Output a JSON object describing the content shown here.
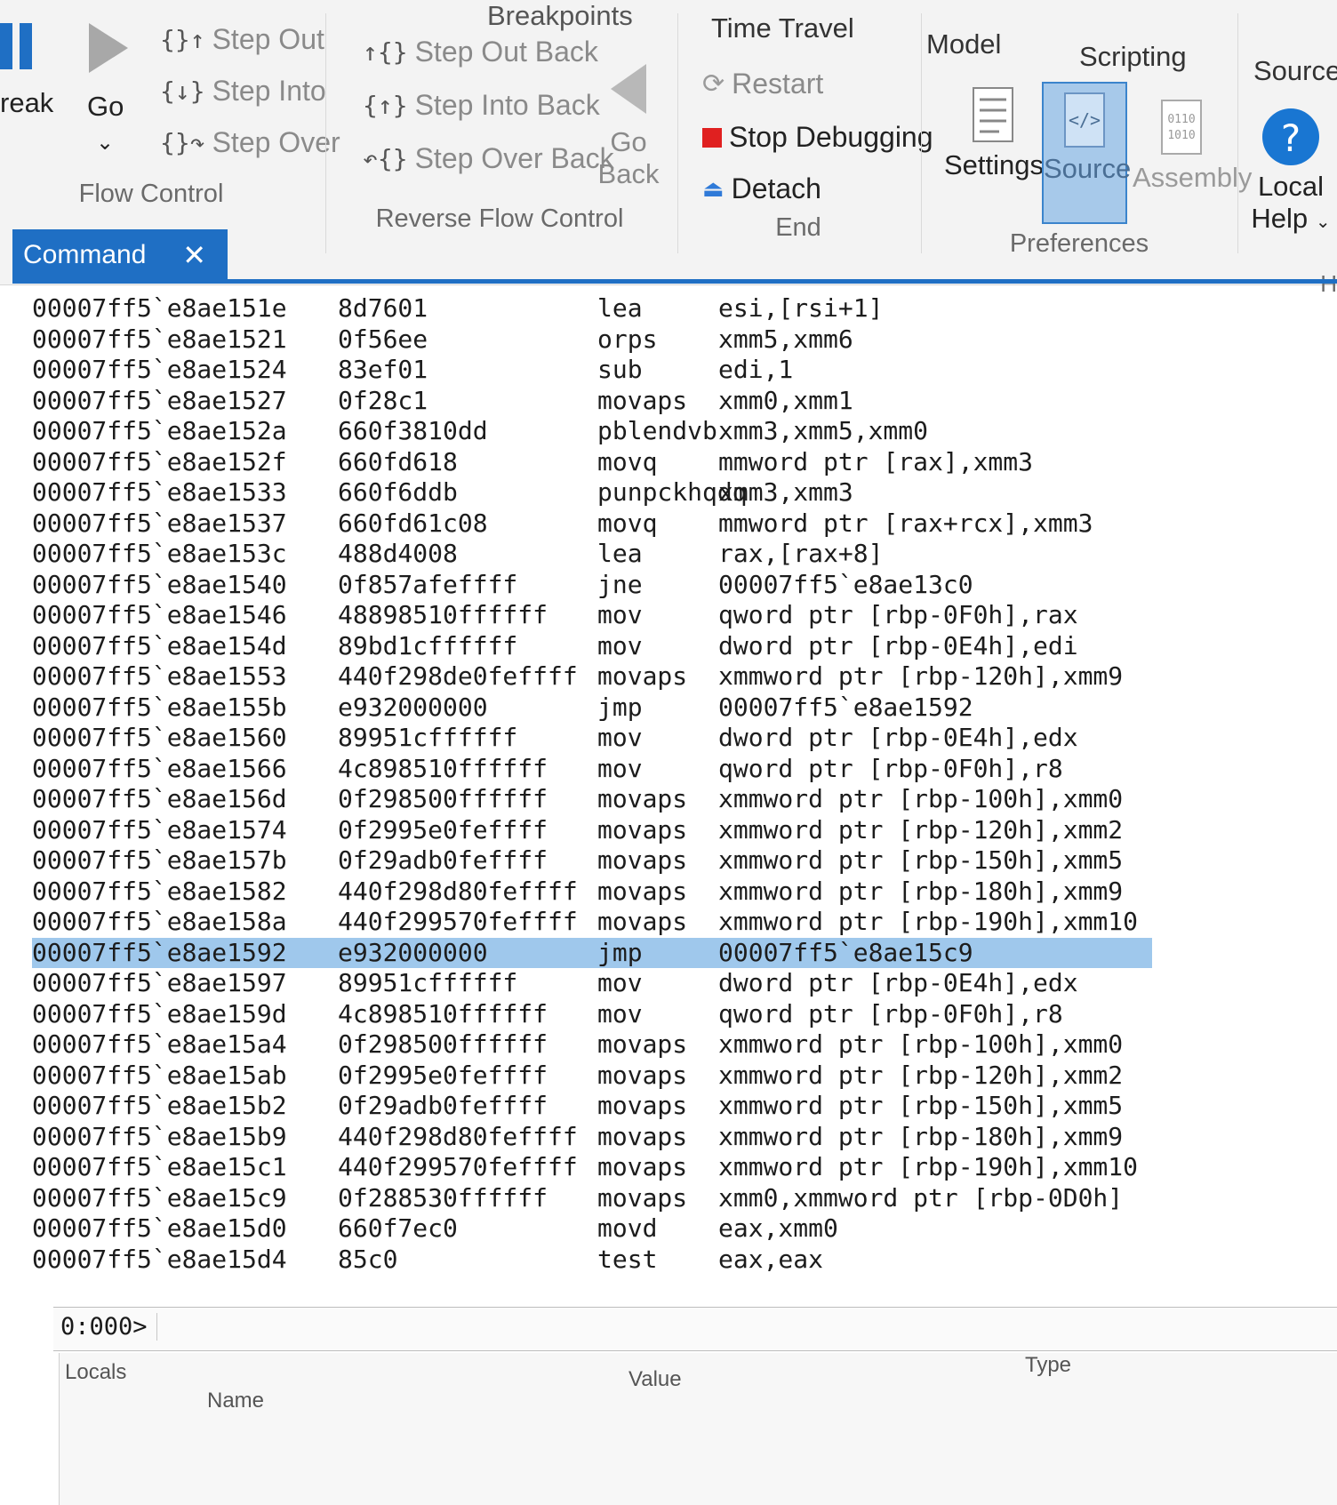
{
  "ribbon": {
    "tabs": [
      "Breakpoints",
      "Time Travel",
      "Model",
      "Scripting",
      "Source"
    ],
    "flow_control": {
      "break_label": "reak",
      "go_label": "Go",
      "step_out": "Step Out",
      "step_into": "Step Into",
      "step_over": "Step Over",
      "group_label": "Flow Control"
    },
    "reverse_flow": {
      "step_out_back": "Step Out Back",
      "step_into_back": "Step Into Back",
      "step_over_back": "Step Over Back",
      "go_back_line1": "Go",
      "go_back_line2": "Back",
      "group_label": "Reverse Flow Control"
    },
    "end": {
      "restart": "Restart",
      "stop_debugging": "Stop Debugging",
      "detach": "Detach",
      "group_label": "End"
    },
    "preferences": {
      "settings": "Settings",
      "source": "Source",
      "assembly": "Assembly",
      "group_label": "Preferences"
    },
    "help": {
      "line1": "Local",
      "line2": "Help",
      "group_label_partial": "H"
    },
    "colors": {
      "accent": "#1f6fc4",
      "stop": "#e02020",
      "detach": "#2f7ad8",
      "help_circle": "#1976d2"
    }
  },
  "command_tab": {
    "label": "Command"
  },
  "disassembly": [
    {
      "addr": "00007ff5`e8ae151e",
      "bytes": "8d7601",
      "mnemonic": "lea",
      "operands": "esi,[rsi+1]"
    },
    {
      "addr": "00007ff5`e8ae1521",
      "bytes": "0f56ee",
      "mnemonic": "orps",
      "operands": "xmm5,xmm6"
    },
    {
      "addr": "00007ff5`e8ae1524",
      "bytes": "83ef01",
      "mnemonic": "sub",
      "operands": "edi,1"
    },
    {
      "addr": "00007ff5`e8ae1527",
      "bytes": "0f28c1",
      "mnemonic": "movaps",
      "operands": "xmm0,xmm1"
    },
    {
      "addr": "00007ff5`e8ae152a",
      "bytes": "660f3810dd",
      "mnemonic": "pblendvb",
      "operands": "xmm3,xmm5,xmm0"
    },
    {
      "addr": "00007ff5`e8ae152f",
      "bytes": "660fd618",
      "mnemonic": "movq",
      "operands": "mmword ptr [rax],xmm3"
    },
    {
      "addr": "00007ff5`e8ae1533",
      "bytes": "660f6ddb",
      "mnemonic": "punpckhqdq",
      "operands": "xmm3,xmm3"
    },
    {
      "addr": "00007ff5`e8ae1537",
      "bytes": "660fd61c08",
      "mnemonic": "movq",
      "operands": "mmword ptr [rax+rcx],xmm3"
    },
    {
      "addr": "00007ff5`e8ae153c",
      "bytes": "488d4008",
      "mnemonic": "lea",
      "operands": "rax,[rax+8]"
    },
    {
      "addr": "00007ff5`e8ae1540",
      "bytes": "0f857afeffff",
      "mnemonic": "jne",
      "operands": "00007ff5`e8ae13c0"
    },
    {
      "addr": "00007ff5`e8ae1546",
      "bytes": "48898510ffffff",
      "mnemonic": "mov",
      "operands": "qword ptr [rbp-0F0h],rax"
    },
    {
      "addr": "00007ff5`e8ae154d",
      "bytes": "89bd1cffffff",
      "mnemonic": "mov",
      "operands": "dword ptr [rbp-0E4h],edi"
    },
    {
      "addr": "00007ff5`e8ae1553",
      "bytes": "440f298de0feffff",
      "mnemonic": "movaps",
      "operands": "xmmword ptr [rbp-120h],xmm9"
    },
    {
      "addr": "00007ff5`e8ae155b",
      "bytes": "e932000000",
      "mnemonic": "jmp",
      "operands": "00007ff5`e8ae1592"
    },
    {
      "addr": "00007ff5`e8ae1560",
      "bytes": "89951cffffff",
      "mnemonic": "mov",
      "operands": "dword ptr [rbp-0E4h],edx"
    },
    {
      "addr": "00007ff5`e8ae1566",
      "bytes": "4c898510ffffff",
      "mnemonic": "mov",
      "operands": "qword ptr [rbp-0F0h],r8"
    },
    {
      "addr": "00007ff5`e8ae156d",
      "bytes": "0f298500ffffff",
      "mnemonic": "movaps",
      "operands": "xmmword ptr [rbp-100h],xmm0"
    },
    {
      "addr": "00007ff5`e8ae1574",
      "bytes": "0f2995e0feffff",
      "mnemonic": "movaps",
      "operands": "xmmword ptr [rbp-120h],xmm2"
    },
    {
      "addr": "00007ff5`e8ae157b",
      "bytes": "0f29adb0feffff",
      "mnemonic": "movaps",
      "operands": "xmmword ptr [rbp-150h],xmm5"
    },
    {
      "addr": "00007ff5`e8ae1582",
      "bytes": "440f298d80feffff",
      "mnemonic": "movaps",
      "operands": "xmmword ptr [rbp-180h],xmm9"
    },
    {
      "addr": "00007ff5`e8ae158a",
      "bytes": "440f299570feffff",
      "mnemonic": "movaps",
      "operands": "xmmword ptr [rbp-190h],xmm10"
    },
    {
      "addr": "00007ff5`e8ae1592",
      "bytes": "e932000000",
      "mnemonic": "jmp",
      "operands": "00007ff5`e8ae15c9",
      "highlight": true
    },
    {
      "addr": "00007ff5`e8ae1597",
      "bytes": "89951cffffff",
      "mnemonic": "mov",
      "operands": "dword ptr [rbp-0E4h],edx"
    },
    {
      "addr": "00007ff5`e8ae159d",
      "bytes": "4c898510ffffff",
      "mnemonic": "mov",
      "operands": "qword ptr [rbp-0F0h],r8"
    },
    {
      "addr": "00007ff5`e8ae15a4",
      "bytes": "0f298500ffffff",
      "mnemonic": "movaps",
      "operands": "xmmword ptr [rbp-100h],xmm0"
    },
    {
      "addr": "00007ff5`e8ae15ab",
      "bytes": "0f2995e0feffff",
      "mnemonic": "movaps",
      "operands": "xmmword ptr [rbp-120h],xmm2"
    },
    {
      "addr": "00007ff5`e8ae15b2",
      "bytes": "0f29adb0feffff",
      "mnemonic": "movaps",
      "operands": "xmmword ptr [rbp-150h],xmm5"
    },
    {
      "addr": "00007ff5`e8ae15b9",
      "bytes": "440f298d80feffff",
      "mnemonic": "movaps",
      "operands": "xmmword ptr [rbp-180h],xmm9"
    },
    {
      "addr": "00007ff5`e8ae15c1",
      "bytes": "440f299570feffff",
      "mnemonic": "movaps",
      "operands": "xmmword ptr [rbp-190h],xmm10"
    },
    {
      "addr": "00007ff5`e8ae15c9",
      "bytes": "0f288530ffffff",
      "mnemonic": "movaps",
      "operands": "xmm0,xmmword ptr [rbp-0D0h]"
    },
    {
      "addr": "00007ff5`e8ae15d0",
      "bytes": "660f7ec0",
      "mnemonic": "movd",
      "operands": "eax,xmm0"
    },
    {
      "addr": "00007ff5`e8ae15d4",
      "bytes": "85c0",
      "mnemonic": "test",
      "operands": "eax,eax"
    }
  ],
  "prompt": {
    "label": "0:000>",
    "value": ""
  },
  "locals": {
    "title": "Locals",
    "columns": {
      "name": "Name",
      "value": "Value",
      "type": "Type"
    }
  }
}
